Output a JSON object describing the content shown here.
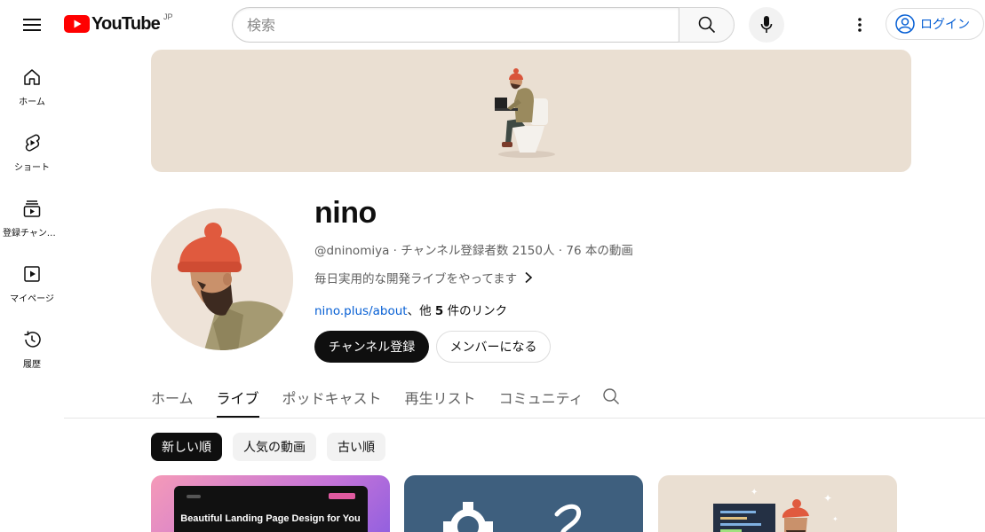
{
  "header": {
    "logo_text": "YouTube",
    "region": "JP",
    "search_placeholder": "検索",
    "login_label": "ログイン"
  },
  "sidebar": {
    "items": [
      {
        "label": "ホーム",
        "icon": "home-icon"
      },
      {
        "label": "ショート",
        "icon": "shorts-icon"
      },
      {
        "label": "登録チャンネル",
        "icon": "subscriptions-icon"
      },
      {
        "label": "マイページ",
        "icon": "my-page-icon"
      },
      {
        "label": "履歴",
        "icon": "history-icon"
      }
    ]
  },
  "channel": {
    "name": "nino",
    "handle": "@dninomiya",
    "subscribers": "チャンネル登録者数 2150人",
    "videos": "76 本の動画",
    "meta_separator": " · ",
    "description": "毎日実用的な開発ライブをやってます",
    "link_text": "nino.plus/about",
    "links_prefix": "、他 ",
    "links_count": "5",
    "links_suffix": " 件のリンク",
    "subscribe_label": "チャンネル登録",
    "member_label": "メンバーになる"
  },
  "tabs": [
    {
      "label": "ホーム",
      "active": false
    },
    {
      "label": "ライブ",
      "active": true
    },
    {
      "label": "ポッドキャスト",
      "active": false
    },
    {
      "label": "再生リスト",
      "active": false
    },
    {
      "label": "コミュニティ",
      "active": false
    }
  ],
  "chips": [
    {
      "label": "新しい順",
      "active": true
    },
    {
      "label": "人気の動画",
      "active": false
    },
    {
      "label": "古い順",
      "active": false
    }
  ],
  "videos": [
    {
      "thumbnail_text": "Beautiful Landing Page Design for You"
    },
    {
      "thumbnail_text": ""
    },
    {
      "thumbnail_text": ""
    }
  ],
  "colors": {
    "brand_red": "#ff0000",
    "link_blue": "#065fd4",
    "banner_bg": "#eadfd2"
  }
}
